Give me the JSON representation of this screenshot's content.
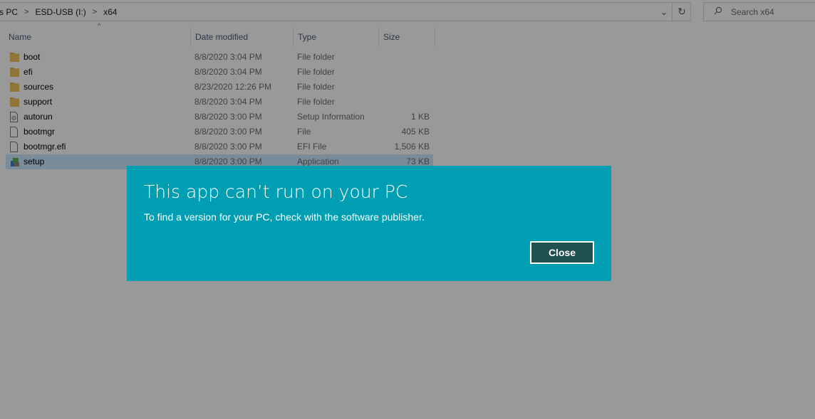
{
  "address_bar": {
    "breadcrumbs": [
      "s PC",
      "ESD-USB (I:)",
      "x64"
    ],
    "separator": ">",
    "dropdown_glyph": "⌄",
    "refresh_glyph": "↻"
  },
  "search": {
    "placeholder": "Search x64",
    "icon": "search-icon"
  },
  "columns": {
    "name": "Name",
    "date": "Date modified",
    "type": "Type",
    "size": "Size",
    "sort_glyph": "^"
  },
  "files": [
    {
      "name": "boot",
      "date": "8/8/2020 3:04 PM",
      "type": "File folder",
      "size": "",
      "icon": "folder-icon"
    },
    {
      "name": "efi",
      "date": "8/8/2020 3:04 PM",
      "type": "File folder",
      "size": "",
      "icon": "folder-icon"
    },
    {
      "name": "sources",
      "date": "8/23/2020 12:26 PM",
      "type": "File folder",
      "size": "",
      "icon": "folder-icon"
    },
    {
      "name": "support",
      "date": "8/8/2020 3:04 PM",
      "type": "File folder",
      "size": "",
      "icon": "folder-icon"
    },
    {
      "name": "autorun",
      "date": "8/8/2020 3:00 PM",
      "type": "Setup Information",
      "size": "1 KB",
      "icon": "setup-information-icon"
    },
    {
      "name": "bootmgr",
      "date": "8/8/2020 3:00 PM",
      "type": "File",
      "size": "405 KB",
      "icon": "file-icon"
    },
    {
      "name": "bootmgr.efi",
      "date": "8/8/2020 3:00 PM",
      "type": "EFI File",
      "size": "1,506 KB",
      "icon": "file-icon"
    },
    {
      "name": "setup",
      "date": "8/8/2020 3:00 PM",
      "type": "Application",
      "size": "73 KB",
      "icon": "setup-application-icon",
      "selected": true
    }
  ],
  "dialog": {
    "title": "This app can’t run on your PC",
    "message": "To find a version for your PC, check with the software publisher.",
    "close_label": "Close",
    "background_color": "#009eb3",
    "button_color": "#205050"
  }
}
